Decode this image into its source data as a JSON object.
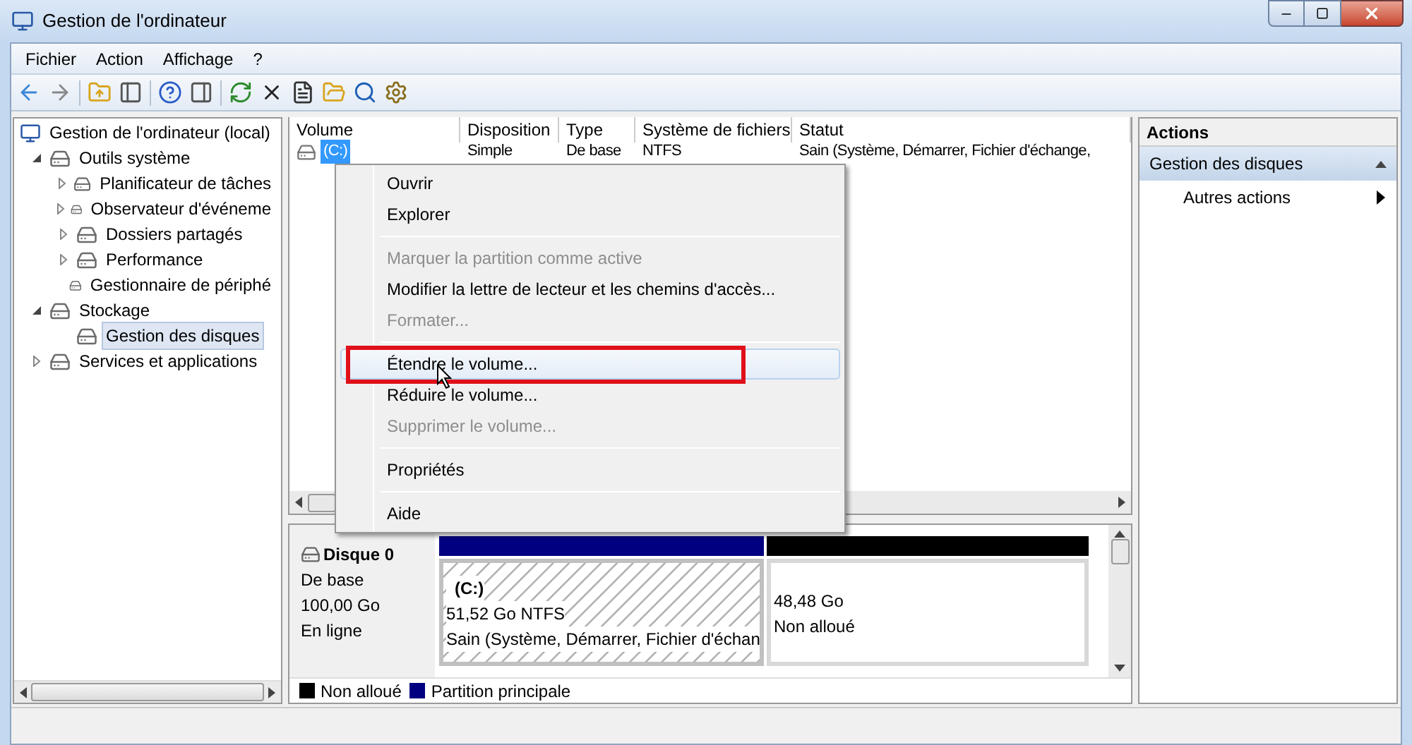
{
  "window": {
    "title": "Gestion de l'ordinateur"
  },
  "menu_bar": [
    "Fichier",
    "Action",
    "Affichage",
    "?"
  ],
  "tree": [
    {
      "label": "Gestion de l'ordinateur (local)",
      "kind": "root",
      "selected": false,
      "children": [
        {
          "label": "Outils système",
          "kind": "branch",
          "expanded": true,
          "selected": false,
          "children": [
            {
              "label": "Planificateur de tâches",
              "kind": "branch",
              "expanded": false,
              "selected": false
            },
            {
              "label": "Observateur d'événeme",
              "kind": "branch",
              "expanded": false,
              "selected": false
            },
            {
              "label": "Dossiers partagés",
              "kind": "branch",
              "expanded": false,
              "selected": false
            },
            {
              "label": "Performance",
              "kind": "branch",
              "expanded": false,
              "selected": false
            },
            {
              "label": "Gestionnaire de périphé",
              "kind": "leaf",
              "selected": false
            }
          ]
        },
        {
          "label": "Stockage",
          "kind": "branch",
          "expanded": true,
          "selected": false,
          "children": [
            {
              "label": "Gestion des disques",
              "kind": "leaf",
              "selected": true
            }
          ]
        },
        {
          "label": "Services et applications",
          "kind": "branch",
          "expanded": false,
          "selected": false
        }
      ]
    }
  ],
  "table": {
    "columns": [
      "Volume",
      "Disposition",
      "Type",
      "Système de fichiers",
      "Statut"
    ],
    "rows": [
      {
        "cells": [
          "(C:)",
          "Simple",
          "De base",
          "NTFS",
          "Sain (Système, Démarrer, Fichier d'échange,"
        ],
        "selected": true
      }
    ]
  },
  "context_menu": [
    {
      "kind": "item",
      "label": "Ouvrir",
      "disabled": false,
      "hovered": false,
      "highlighted": false
    },
    {
      "kind": "item",
      "label": "Explorer",
      "disabled": false,
      "hovered": false,
      "highlighted": false
    },
    {
      "kind": "separator"
    },
    {
      "kind": "item",
      "label": "Marquer la partition comme active",
      "disabled": true,
      "hovered": false,
      "highlighted": false
    },
    {
      "kind": "item",
      "label": "Modifier la lettre de lecteur et les chemins d'accès...",
      "disabled": false,
      "hovered": false,
      "highlighted": false
    },
    {
      "kind": "item",
      "label": "Formater...",
      "disabled": true,
      "hovered": false,
      "highlighted": false
    },
    {
      "kind": "separator"
    },
    {
      "kind": "item",
      "label": "Étendre le volume...",
      "disabled": false,
      "hovered": true,
      "highlighted": true
    },
    {
      "kind": "item",
      "label": "Réduire le volume...",
      "disabled": false,
      "hovered": false,
      "highlighted": false
    },
    {
      "kind": "item",
      "label": "Supprimer le volume...",
      "disabled": true,
      "hovered": false,
      "highlighted": false
    },
    {
      "kind": "separator"
    },
    {
      "kind": "item",
      "label": "Propriétés",
      "disabled": false,
      "hovered": false,
      "highlighted": false
    },
    {
      "kind": "separator"
    },
    {
      "kind": "item",
      "label": "Aide",
      "disabled": false,
      "hovered": false,
      "highlighted": false
    }
  ],
  "disk": {
    "name": "Disque 0",
    "lines": [
      "De base",
      "100,00 Go",
      "En ligne"
    ],
    "partitions": [
      {
        "title": "(C:)",
        "lines": [
          "51,52 Go NTFS",
          "Sain (Système, Démarrer, Fichier d'échan"
        ],
        "color": "#000080",
        "selected": true
      },
      {
        "lines": [
          "48,48 Go",
          "Non alloué"
        ],
        "color": "#000000",
        "selected": false
      }
    ]
  },
  "legend": [
    {
      "label": "Non alloué",
      "color": "#000000"
    },
    {
      "label": "Partition principale",
      "color": "#000080"
    }
  ],
  "actions": {
    "title": "Actions",
    "sections": [
      {
        "label": "Gestion des disques",
        "expanded": true,
        "items": [
          "Autres actions"
        ]
      }
    ]
  }
}
